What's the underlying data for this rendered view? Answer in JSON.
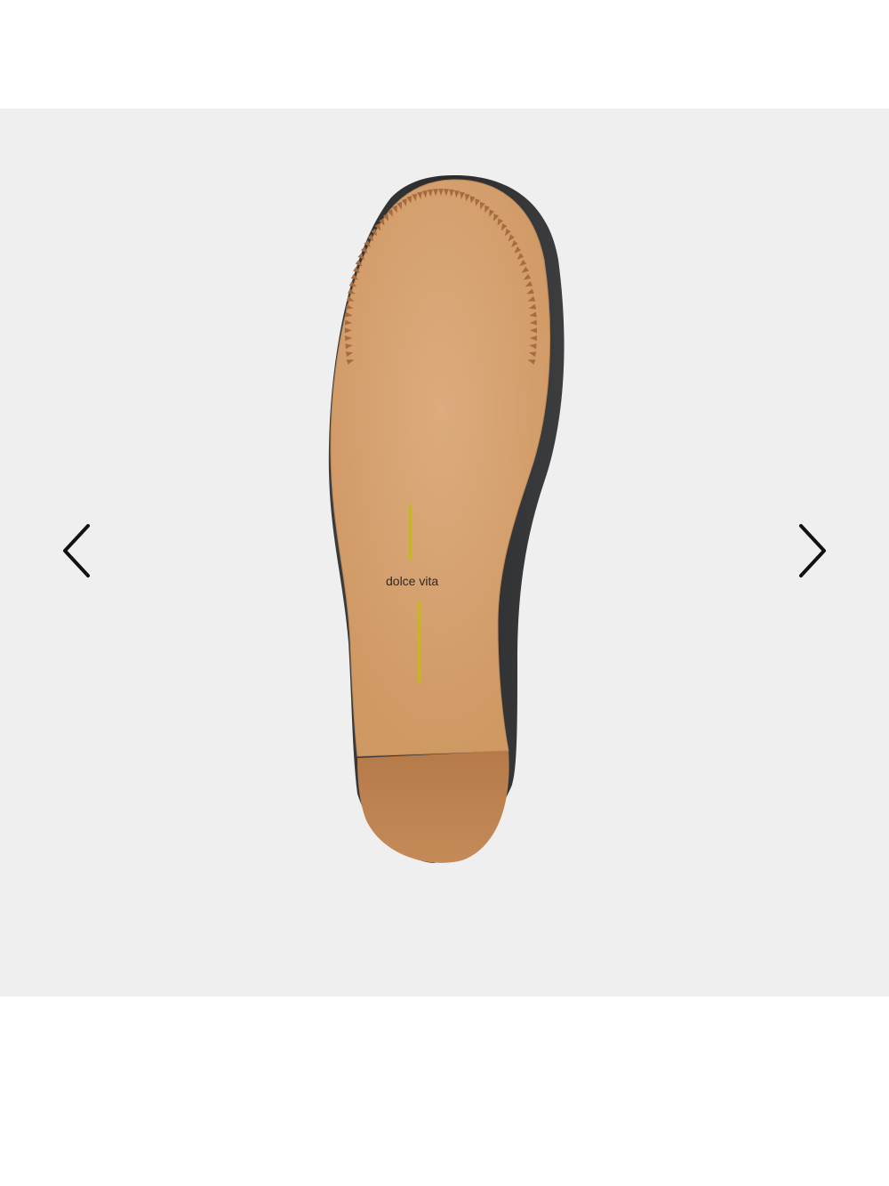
{
  "gallery": {
    "brand_label": "dolce vita",
    "prev_icon": "chevron-left-icon",
    "next_icon": "chevron-right-icon",
    "colors": {
      "background": "#efefef",
      "sole": "#d6a06f",
      "heel": "#bc8352",
      "upper": "#2f3032",
      "logo_mark": "#c8b32a"
    }
  }
}
